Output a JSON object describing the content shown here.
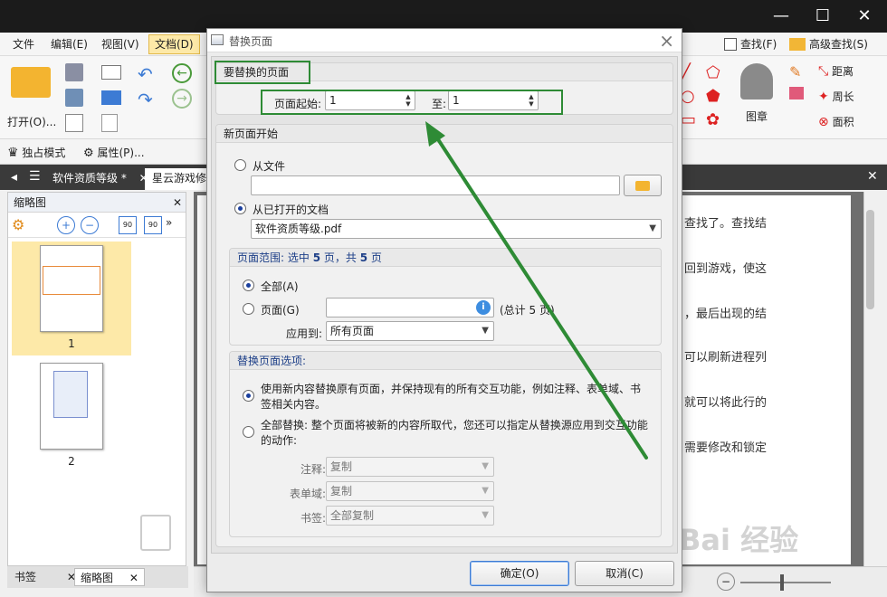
{
  "menu": {
    "file": "文件",
    "edit": "编辑(E)",
    "view": "视图(V)",
    "document": "文档(D)",
    "find": "查找(F)",
    "advanced_find": "高级查找(S)"
  },
  "ribbon": {
    "open_label": "打开(O)...",
    "stamp_label": "图章",
    "distance_label": "距离",
    "perimeter_label": "周长",
    "area_label": "面积"
  },
  "subbar": {
    "exclusive_mode": "独占模式",
    "properties": "属性(P)..."
  },
  "tabs": [
    {
      "label": "软件资质等级 *"
    },
    {
      "label": "星云游戏修"
    }
  ],
  "left_panel": {
    "title": "缩略图",
    "thumbnails": [
      {
        "num": "1"
      },
      {
        "num": "2"
      }
    ],
    "bottom_tabs": {
      "bookmarks": "书签",
      "thumbnails": "缩略图"
    }
  },
  "document_lines": [
    "查找了。查找结",
    "回到游戏，使这",
    "，最后出现的结",
    "可以刷新进程列",
    "就可以将此行的",
    "需要修改和锁定"
  ],
  "dialog": {
    "title": "替换页面",
    "section_replace": {
      "header": "要替换的页面",
      "from_label": "页面起始:",
      "from_value": "1",
      "to_label": "至:",
      "to_value": "1"
    },
    "section_new": {
      "header": "新页面开始",
      "from_file": "从文件",
      "file_path": "",
      "from_open_doc": "从已打开的文档",
      "open_doc_value": "软件资质等级.pdf"
    },
    "section_range": {
      "header_prefix": "页面范围: 选中",
      "selected_count": "5",
      "header_mid": "页，共",
      "total_count": "5",
      "header_suffix": "页",
      "all": "全部(A)",
      "pages": "页面(G)",
      "pages_value": "",
      "total_hint": "(总计 5 页)",
      "apply_to_label": "应用到:",
      "apply_to_value": "所有页面"
    },
    "section_options": {
      "header": "替换页面选项:",
      "option1": "使用新内容替换原有页面，并保持现有的所有交互功能，例如注释、表单域、书签相关内容。",
      "option2": "全部替换: 整个页面将被新的内容所取代，您还可以指定从替换源应用到交互功能的动作:",
      "annotations_label": "注释:",
      "annotations_value": "复制",
      "form_fields_label": "表单域:",
      "form_fields_value": "复制",
      "bookmarks_label": "书签:",
      "bookmarks_value": "全部复制"
    },
    "ok": "确定(O)",
    "cancel": "取消(C)"
  },
  "watermark": "Bai 经验",
  "colors": {
    "highlight_green": "#2e8b35",
    "accent_blue": "#1d3f88"
  }
}
